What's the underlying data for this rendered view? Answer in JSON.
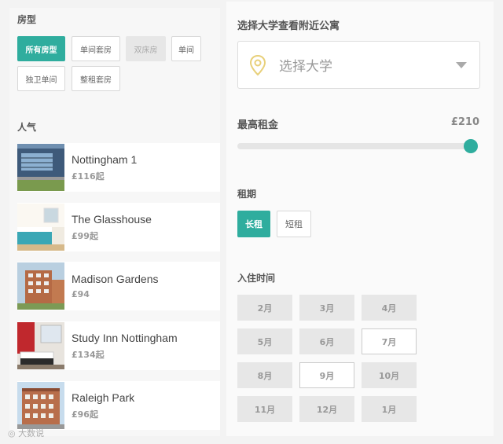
{
  "filters": {
    "room_type_label": "房型",
    "room_types": [
      "所有房型",
      "单间套房",
      "双床房",
      "单间",
      "独卫单间",
      "整租套房"
    ],
    "popular_label": "人气"
  },
  "listings": [
    {
      "name": "Nottingham 1",
      "price": "£116起"
    },
    {
      "name": "The Glasshouse",
      "price": "£99起"
    },
    {
      "name": "Madison Gardens",
      "price": "£94"
    },
    {
      "name": "Study Inn Nottingham",
      "price": "£134起"
    },
    {
      "name": "Raleigh Park",
      "price": "£96起"
    }
  ],
  "right": {
    "university_label": "选择大学查看附近公寓",
    "university_placeholder": "选择大学",
    "max_rent_label": "最高租金",
    "max_rent_value": "£210",
    "max_rent_fraction": 1.0,
    "lease_label": "租期",
    "lease_options": [
      "长租",
      "短租"
    ],
    "movein_label": "入住时间",
    "months": [
      "2月",
      "3月",
      "4月",
      "5月",
      "6月",
      "7月",
      "8月",
      "9月",
      "10月",
      "11月",
      "12月",
      "1月"
    ]
  },
  "watermark": "大数说"
}
